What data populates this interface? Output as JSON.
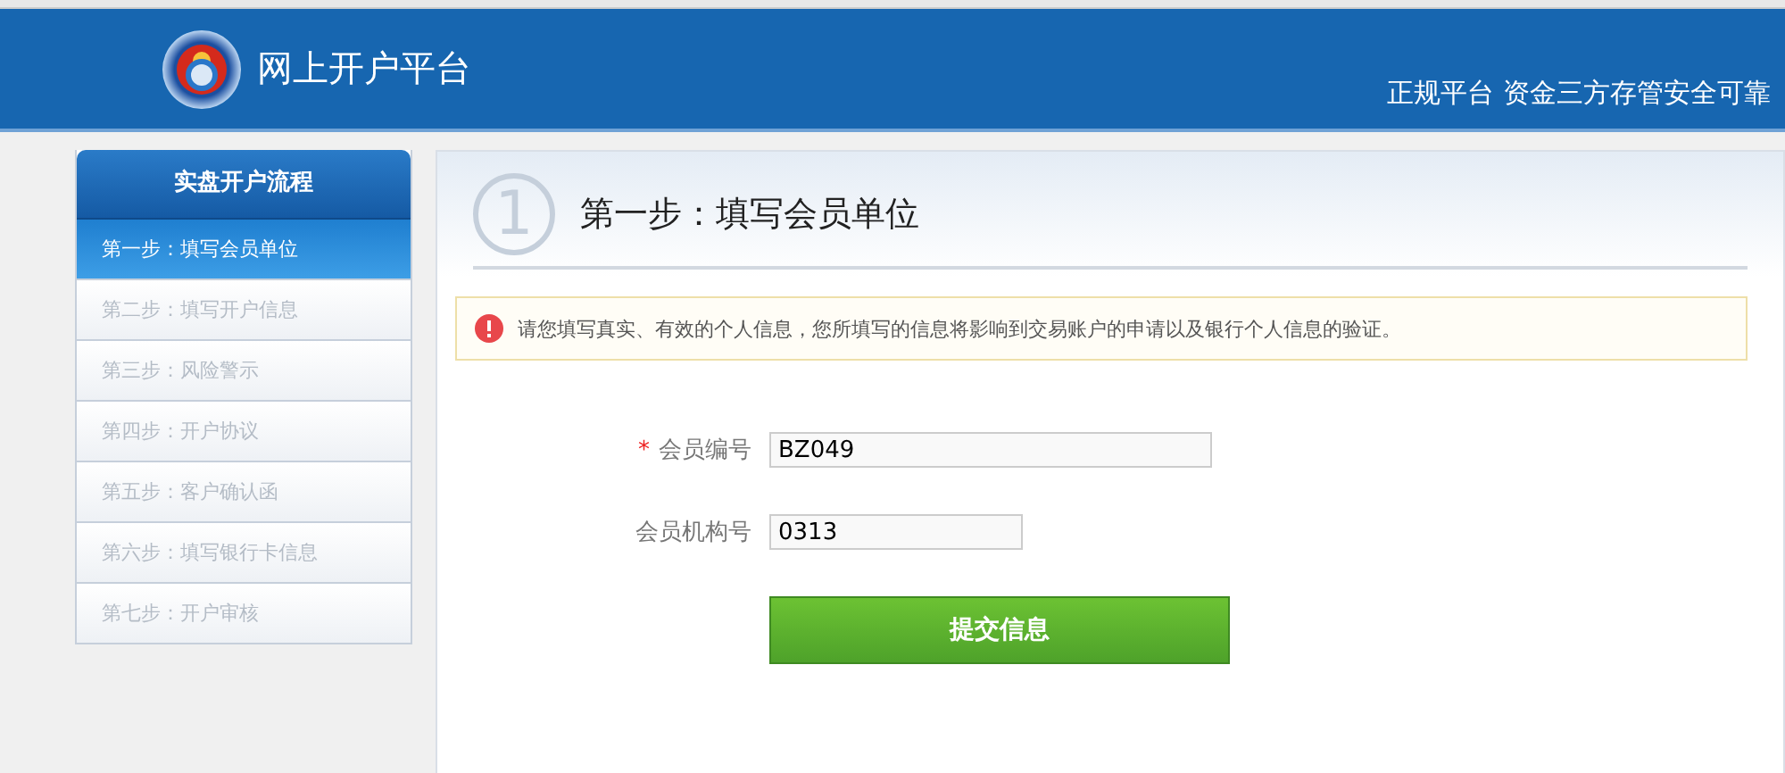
{
  "header": {
    "title": "网上开户平台",
    "tagline": "正规平台 资金三方存管安全可靠"
  },
  "sidebar": {
    "title": "实盘开户流程",
    "items": [
      {
        "label": "第一步：填写会员单位",
        "selected": true
      },
      {
        "label": "第二步：填写开户信息",
        "selected": false
      },
      {
        "label": "第三步：风险警示",
        "selected": false
      },
      {
        "label": "第四步：开户协议",
        "selected": false
      },
      {
        "label": "第五步：客户确认函",
        "selected": false
      },
      {
        "label": "第六步：填写银行卡信息",
        "selected": false
      },
      {
        "label": "第七步：开户审核",
        "selected": false
      }
    ]
  },
  "step": {
    "number": "1",
    "title": "第一步：填写会员单位"
  },
  "notice": "请您填写真实、有效的个人信息，您所填写的信息将影响到交易账户的申请以及银行个人信息的验证。",
  "form": {
    "fields": [
      {
        "label": "会员编号",
        "required_mark": "*",
        "value": "BZ049",
        "wide": true
      },
      {
        "label": "会员机构号",
        "value": "0313",
        "wide": false
      }
    ],
    "submit": "提交信息"
  }
}
